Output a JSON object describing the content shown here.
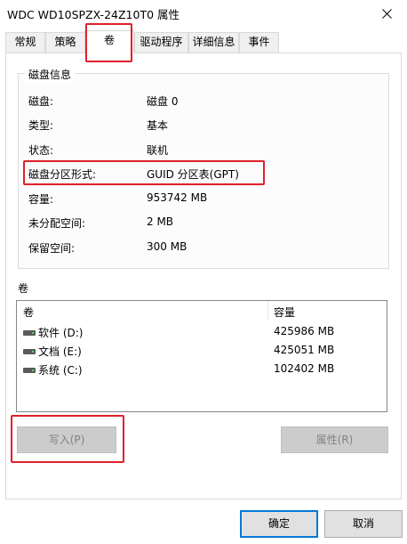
{
  "window": {
    "title": "WDC WD10SPZX-24Z10T0 属性"
  },
  "tabs": [
    {
      "label": "常规",
      "active": false
    },
    {
      "label": "策略",
      "active": false
    },
    {
      "label": "卷",
      "active": true
    },
    {
      "label": "驱动程序",
      "active": false
    },
    {
      "label": "详细信息",
      "active": false
    },
    {
      "label": "事件",
      "active": false
    }
  ],
  "disk_info": {
    "group_title": "磁盘信息",
    "rows": [
      {
        "label": "磁盘:",
        "value": "磁盘 0"
      },
      {
        "label": "类型:",
        "value": "基本"
      },
      {
        "label": "状态:",
        "value": "联机"
      },
      {
        "label": "磁盘分区形式:",
        "value": "GUID 分区表(GPT)"
      },
      {
        "label": "容量:",
        "value": "953742 MB"
      },
      {
        "label": "未分配空间:",
        "value": "2 MB"
      },
      {
        "label": "保留空间:",
        "value": "300 MB"
      }
    ]
  },
  "volumes": {
    "section_label": "卷",
    "columns": [
      "卷",
      "容量"
    ],
    "rows": [
      {
        "name": "软件 (D:)",
        "capacity": "425986 MB",
        "icon": "drive-icon"
      },
      {
        "name": "文档 (E:)",
        "capacity": "425051 MB",
        "icon": "drive-icon"
      },
      {
        "name": "系统 (C:)",
        "capacity": "102402 MB",
        "icon": "drive-icon"
      }
    ]
  },
  "buttons": {
    "populate": "写入(P)",
    "properties": "属性(R)",
    "ok": "确定",
    "cancel": "取消"
  },
  "colors": {
    "annotation": "#e0202a",
    "primary_border": "#0078d7"
  }
}
